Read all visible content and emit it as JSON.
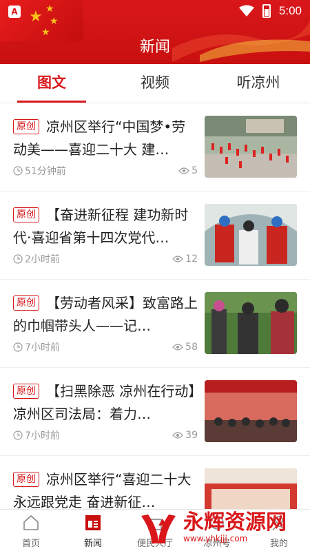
{
  "status": {
    "time": "5:00"
  },
  "header": {
    "title": "新闻"
  },
  "tabs": [
    {
      "label": "图文",
      "active": true
    },
    {
      "label": "视频",
      "active": false
    },
    {
      "label": "听凉州",
      "active": false
    }
  ],
  "badge": "原创",
  "articles": [
    {
      "title": "凉州区举行“中国梦•劳动美——喜迎二十大 建…",
      "time": "51分钟前",
      "views": "5"
    },
    {
      "title": "【奋进新征程 建功新时代·喜迎省第十四次党代…",
      "time": "2小时前",
      "views": "12"
    },
    {
      "title": "【劳动者风采】致富路上的巾帼带头人——记…",
      "time": "7小时前",
      "views": "58"
    },
    {
      "title": "【扫黑除恶 凉州在行动】凉州区司法局：着力…",
      "time": "7小时前",
      "views": "39"
    },
    {
      "title": "凉州区举行“喜迎二十大 永远跟党走 奋进新征…",
      "time": "",
      "views": ""
    }
  ],
  "bottom_nav": [
    {
      "label": "首页",
      "active": false
    },
    {
      "label": "新闻",
      "active": true
    },
    {
      "label": "便民大厅",
      "active": false
    },
    {
      "label": "凉州号",
      "active": false
    },
    {
      "label": "我的",
      "active": false
    }
  ],
  "watermark": {
    "name": "永辉资源网",
    "url": "www.yhkjjj.com"
  },
  "colors": {
    "brand_red": "#d9171a"
  }
}
